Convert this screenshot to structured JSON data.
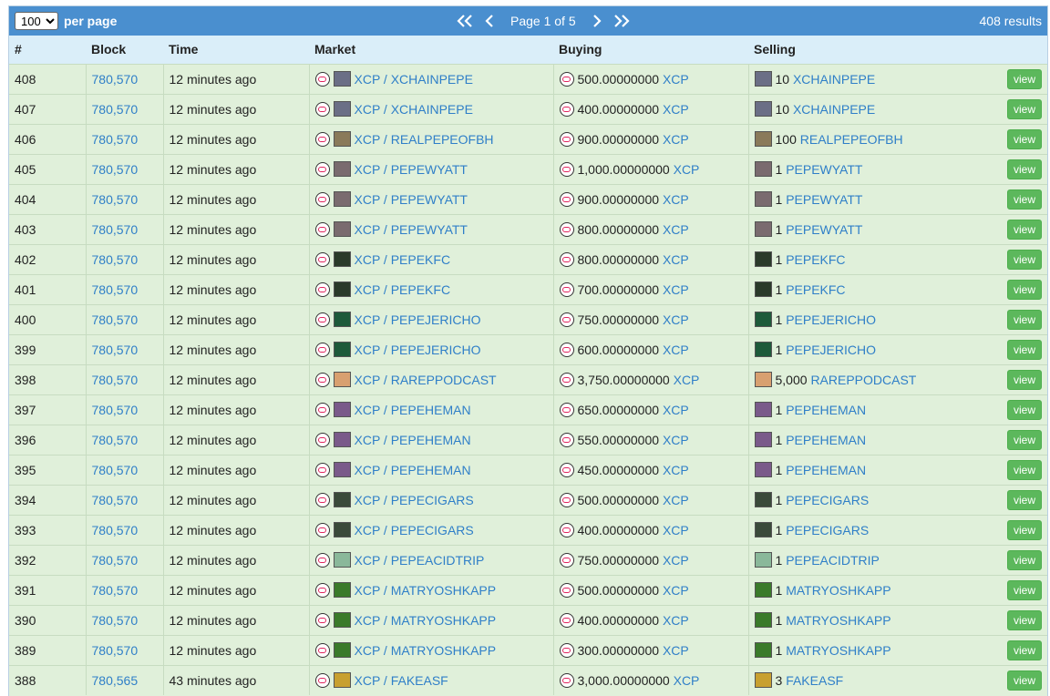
{
  "toolbar": {
    "per_page_value": "100",
    "per_page_label": "per page",
    "page_info": "Page 1 of 5",
    "results": "408 results"
  },
  "columns": [
    "#",
    "Block",
    "Time",
    "Market",
    "Buying",
    "Selling",
    ""
  ],
  "rows": [
    {
      "num": "408",
      "block": "780,570",
      "time": "12 minutes ago",
      "market": "XCP / XCHAINPEPE",
      "buy_amt": "500.00000000",
      "buy_asset": "XCP",
      "sell_amt": "10",
      "sell_asset": "XCHAINPEPE",
      "view": "view",
      "icon_color": "#6b6f86"
    },
    {
      "num": "407",
      "block": "780,570",
      "time": "12 minutes ago",
      "market": "XCP / XCHAINPEPE",
      "buy_amt": "400.00000000",
      "buy_asset": "XCP",
      "sell_amt": "10",
      "sell_asset": "XCHAINPEPE",
      "view": "view",
      "icon_color": "#6b6f86"
    },
    {
      "num": "406",
      "block": "780,570",
      "time": "12 minutes ago",
      "market": "XCP / REALPEPEOFBH",
      "buy_amt": "900.00000000",
      "buy_asset": "XCP",
      "sell_amt": "100",
      "sell_asset": "REALPEPEOFBH",
      "view": "view",
      "icon_color": "#8a7a5a"
    },
    {
      "num": "405",
      "block": "780,570",
      "time": "12 minutes ago",
      "market": "XCP / PEPEWYATT",
      "buy_amt": "1,000.00000000",
      "buy_asset": "XCP",
      "sell_amt": "1",
      "sell_asset": "PEPEWYATT",
      "view": "view",
      "icon_color": "#7a6b6f"
    },
    {
      "num": "404",
      "block": "780,570",
      "time": "12 minutes ago",
      "market": "XCP / PEPEWYATT",
      "buy_amt": "900.00000000",
      "buy_asset": "XCP",
      "sell_amt": "1",
      "sell_asset": "PEPEWYATT",
      "view": "view",
      "icon_color": "#7a6b6f"
    },
    {
      "num": "403",
      "block": "780,570",
      "time": "12 minutes ago",
      "market": "XCP / PEPEWYATT",
      "buy_amt": "800.00000000",
      "buy_asset": "XCP",
      "sell_amt": "1",
      "sell_asset": "PEPEWYATT",
      "view": "view",
      "icon_color": "#7a6b6f"
    },
    {
      "num": "402",
      "block": "780,570",
      "time": "12 minutes ago",
      "market": "XCP / PEPEKFC",
      "buy_amt": "800.00000000",
      "buy_asset": "XCP",
      "sell_amt": "1",
      "sell_asset": "PEPEKFC",
      "view": "view",
      "icon_color": "#2a3a2a"
    },
    {
      "num": "401",
      "block": "780,570",
      "time": "12 minutes ago",
      "market": "XCP / PEPEKFC",
      "buy_amt": "700.00000000",
      "buy_asset": "XCP",
      "sell_amt": "1",
      "sell_asset": "PEPEKFC",
      "view": "view",
      "icon_color": "#2a3a2a"
    },
    {
      "num": "400",
      "block": "780,570",
      "time": "12 minutes ago",
      "market": "XCP / PEPEJERICHO",
      "buy_amt": "750.00000000",
      "buy_asset": "XCP",
      "sell_amt": "1",
      "sell_asset": "PEPEJERICHO",
      "view": "view",
      "icon_color": "#1d5a3a"
    },
    {
      "num": "399",
      "block": "780,570",
      "time": "12 minutes ago",
      "market": "XCP / PEPEJERICHO",
      "buy_amt": "600.00000000",
      "buy_asset": "XCP",
      "sell_amt": "1",
      "sell_asset": "PEPEJERICHO",
      "view": "view",
      "icon_color": "#1d5a3a"
    },
    {
      "num": "398",
      "block": "780,570",
      "time": "12 minutes ago",
      "market": "XCP / RAREPPODCAST",
      "buy_amt": "3,750.00000000",
      "buy_asset": "XCP",
      "sell_amt": "5,000",
      "sell_asset": "RAREPPODCAST",
      "view": "view",
      "icon_color": "#d8a070"
    },
    {
      "num": "397",
      "block": "780,570",
      "time": "12 minutes ago",
      "market": "XCP / PEPEHEMAN",
      "buy_amt": "650.00000000",
      "buy_asset": "XCP",
      "sell_amt": "1",
      "sell_asset": "PEPEHEMAN",
      "view": "view",
      "icon_color": "#7a5a8a"
    },
    {
      "num": "396",
      "block": "780,570",
      "time": "12 minutes ago",
      "market": "XCP / PEPEHEMAN",
      "buy_amt": "550.00000000",
      "buy_asset": "XCP",
      "sell_amt": "1",
      "sell_asset": "PEPEHEMAN",
      "view": "view",
      "icon_color": "#7a5a8a"
    },
    {
      "num": "395",
      "block": "780,570",
      "time": "12 minutes ago",
      "market": "XCP / PEPEHEMAN",
      "buy_amt": "450.00000000",
      "buy_asset": "XCP",
      "sell_amt": "1",
      "sell_asset": "PEPEHEMAN",
      "view": "view",
      "icon_color": "#7a5a8a"
    },
    {
      "num": "394",
      "block": "780,570",
      "time": "12 minutes ago",
      "market": "XCP / PEPECIGARS",
      "buy_amt": "500.00000000",
      "buy_asset": "XCP",
      "sell_amt": "1",
      "sell_asset": "PEPECIGARS",
      "view": "view",
      "icon_color": "#3a4a3a"
    },
    {
      "num": "393",
      "block": "780,570",
      "time": "12 minutes ago",
      "market": "XCP / PEPECIGARS",
      "buy_amt": "400.00000000",
      "buy_asset": "XCP",
      "sell_amt": "1",
      "sell_asset": "PEPECIGARS",
      "view": "view",
      "icon_color": "#3a4a3a"
    },
    {
      "num": "392",
      "block": "780,570",
      "time": "12 minutes ago",
      "market": "XCP / PEPEACIDTRIP",
      "buy_amt": "750.00000000",
      "buy_asset": "XCP",
      "sell_amt": "1",
      "sell_asset": "PEPEACIDTRIP",
      "view": "view",
      "icon_color": "#8ab89a"
    },
    {
      "num": "391",
      "block": "780,570",
      "time": "12 minutes ago",
      "market": "XCP / MATRYOSHKAPP",
      "buy_amt": "500.00000000",
      "buy_asset": "XCP",
      "sell_amt": "1",
      "sell_asset": "MATRYOSHKAPP",
      "view": "view",
      "icon_color": "#3a7a2a"
    },
    {
      "num": "390",
      "block": "780,570",
      "time": "12 minutes ago",
      "market": "XCP / MATRYOSHKAPP",
      "buy_amt": "400.00000000",
      "buy_asset": "XCP",
      "sell_amt": "1",
      "sell_asset": "MATRYOSHKAPP",
      "view": "view",
      "icon_color": "#3a7a2a"
    },
    {
      "num": "389",
      "block": "780,570",
      "time": "12 minutes ago",
      "market": "XCP / MATRYOSHKAPP",
      "buy_amt": "300.00000000",
      "buy_asset": "XCP",
      "sell_amt": "1",
      "sell_asset": "MATRYOSHKAPP",
      "view": "view",
      "icon_color": "#3a7a2a"
    },
    {
      "num": "388",
      "block": "780,565",
      "time": "43 minutes ago",
      "market": "XCP / FAKEASF",
      "buy_amt": "3,000.00000000",
      "buy_asset": "XCP",
      "sell_amt": "3",
      "sell_asset": "FAKEASF",
      "view": "view",
      "icon_color": "#c8a030"
    }
  ]
}
